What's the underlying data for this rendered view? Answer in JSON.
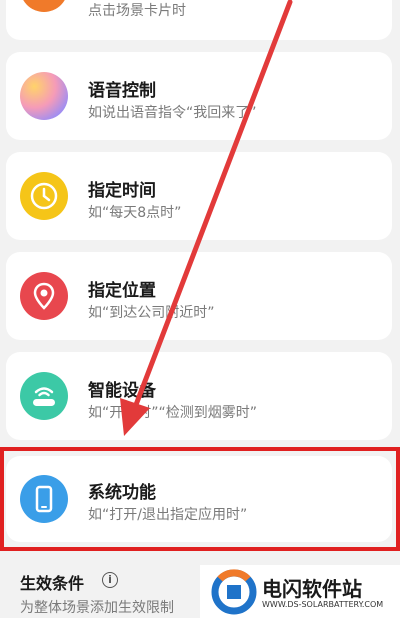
{
  "cards": [
    {
      "title": "",
      "subtitle": "点击场景卡片时",
      "icon": "orange-scene-icon"
    },
    {
      "title": "语音控制",
      "subtitle": "如说出语音指令“我回来了”",
      "icon": "voice-gradient-icon"
    },
    {
      "title": "指定时间",
      "subtitle": "如“每天8点时”",
      "icon": "clock-icon"
    },
    {
      "title": "指定位置",
      "subtitle": "如“到达公司附近时”",
      "icon": "location-pin-icon"
    },
    {
      "title": "智能设备",
      "subtitle": "如“开灯时”“检测到烟雾时”",
      "icon": "router-device-icon"
    },
    {
      "title": "系统功能",
      "subtitle": "如“打开/退出指定应用时”",
      "icon": "phone-icon"
    }
  ],
  "footer": {
    "title": "生效条件",
    "subtitle": "为整体场景添加生效限制"
  },
  "watermark": {
    "name": "电闪软件站",
    "url": "WWW.DS-SOLARBATTERY.COM"
  },
  "colors": {
    "highlight": "#e02020",
    "arrow": "#e23a3a",
    "clock": "#f5c518",
    "location": "#e8474e",
    "device": "#3cc9a6",
    "phone": "#3a9ee8",
    "scene": "#f07a2a"
  }
}
